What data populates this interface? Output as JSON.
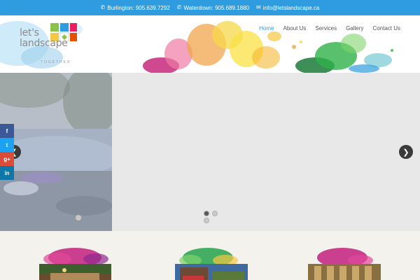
{
  "topbar": {
    "phone_1": "Burlington: 905.639.7292",
    "phone_2": "Waterdown: 905.689.1880",
    "email": "info@letslandscape.ca"
  },
  "logo": {
    "line1": "let's",
    "line2": "landscape",
    "tagline": "TOGETHER"
  },
  "nav": {
    "items": [
      {
        "label": "Home",
        "active": true
      },
      {
        "label": "About Us"
      },
      {
        "label": "Services"
      },
      {
        "label": "Gallery"
      },
      {
        "label": "Contact Us"
      }
    ]
  },
  "slider": {
    "prev_icon": "chevron-left-icon",
    "next_icon": "chevron-right-icon",
    "dot_count": 3,
    "active_dot": 1
  },
  "social": {
    "items": [
      {
        "icon": "facebook-icon",
        "glyph": "f"
      },
      {
        "icon": "twitter-icon",
        "glyph": "t"
      },
      {
        "icon": "google-plus-icon",
        "glyph": "g+"
      },
      {
        "icon": "linkedin-icon",
        "glyph": "in"
      }
    ]
  },
  "colors": {
    "accent": "#2f9ce0",
    "topbar": "#2f9ce0",
    "slider_bg": "#e8e8e8",
    "bottom_bg": "#f3f2ec"
  }
}
